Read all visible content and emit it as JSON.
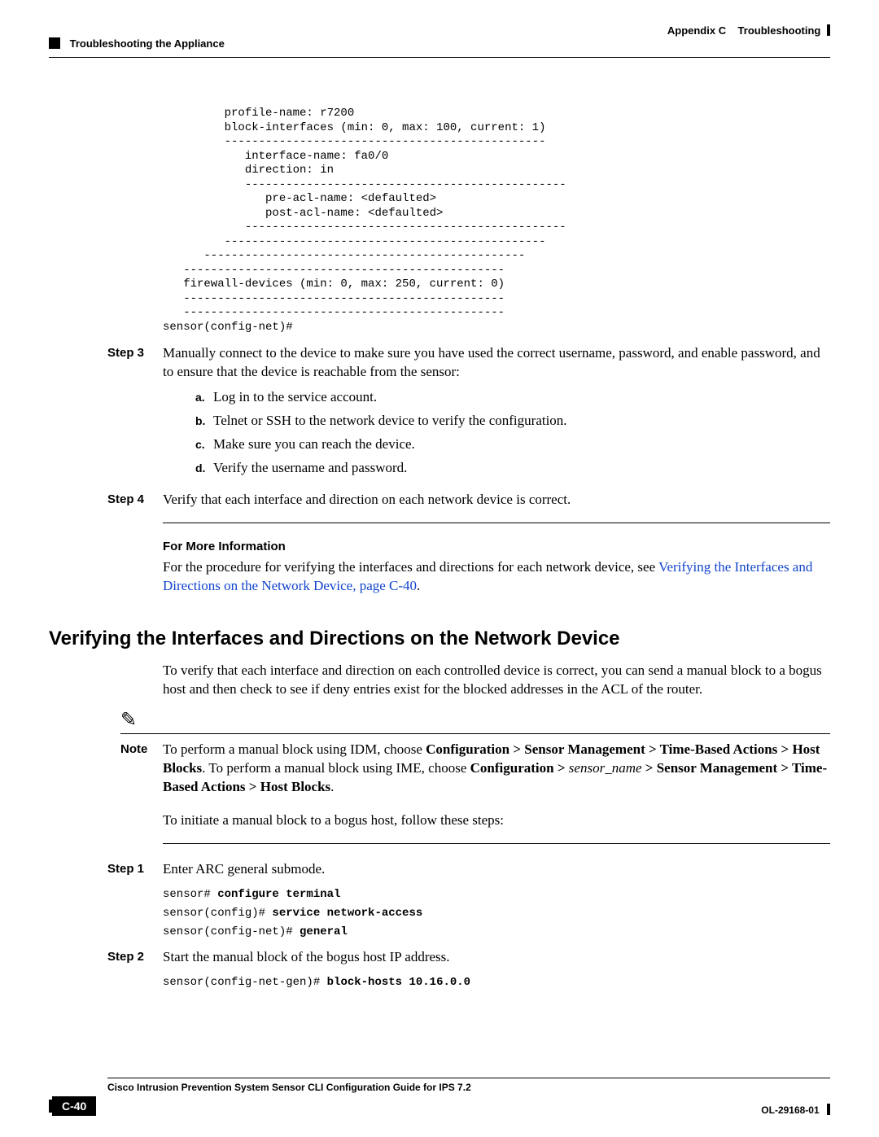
{
  "header": {
    "appendix": "Appendix C",
    "appendix_title": "Troubleshooting",
    "section": "Troubleshooting the Appliance"
  },
  "config_block": "         profile-name: r7200\n         block-interfaces (min: 0, max: 100, current: 1)\n         -----------------------------------------------\n            interface-name: fa0/0\n            direction: in\n            -----------------------------------------------\n               pre-acl-name: <defaulted>\n               post-acl-name: <defaulted>\n            -----------------------------------------------\n         -----------------------------------------------\n      -----------------------------------------------\n   -----------------------------------------------\n   firewall-devices (min: 0, max: 250, current: 0)\n   -----------------------------------------------\n   -----------------------------------------------\nsensor(config-net)#",
  "steps_a": {
    "s3_label": "Step 3",
    "s3_text": "Manually connect to the device to make sure you have used the correct username, password, and enable password, and to ensure that the device is reachable from the sensor:",
    "s3_a_l": "a.",
    "s3_a_t": "Log in to the service account.",
    "s3_b_l": "b.",
    "s3_b_t": "Telnet or SSH to the network device to verify the configuration.",
    "s3_c_l": "c.",
    "s3_c_t": "Make sure you can reach the device.",
    "s3_d_l": "d.",
    "s3_d_t": "Verify the username and password.",
    "s4_label": "Step 4",
    "s4_text": "Verify that each interface and direction on each network device is correct."
  },
  "more_info": {
    "heading": "For More Information",
    "pre": "For the procedure for verifying the interfaces and directions for each network device, see ",
    "link": "Verifying the Interfaces and Directions on the Network Device, page C-40",
    "post": "."
  },
  "section_heading": "Verifying the Interfaces and Directions on the Network Device",
  "intro_para": "To verify that each interface and direction on each controlled device is correct, you can send a manual block to a bogus host and then check to see if deny entries exist for the blocked addresses in the ACL of the router.",
  "note": {
    "label": "Note",
    "p1_pre": "To perform a manual block using IDM, choose ",
    "p1_b1": "Configuration > Sensor Management > Time-Based Actions > Host Blocks",
    "p1_mid": ". To perform a manual block using IME, choose ",
    "p1_b2": "Configuration > ",
    "p1_it": "sensor_name",
    "p1_b3": " > Sensor Management > Time-Based Actions > Host Blocks",
    "p1_post": "."
  },
  "initiate_para": "To initiate a manual block to a bogus host, follow these steps:",
  "steps_b": {
    "s1_label": "Step 1",
    "s1_text": "Enter ARC general submode.",
    "s1_code_l1_a": "sensor# ",
    "s1_code_l1_b": "configure terminal",
    "s1_code_l2_a": "sensor(config)# ",
    "s1_code_l2_b": "service network-access",
    "s1_code_l3_a": "sensor(config-net)# ",
    "s1_code_l3_b": "general",
    "s2_label": "Step 2",
    "s2_text": "Start the manual block of the bogus host IP address.",
    "s2_code_l1_a": "sensor(config-net-gen)# ",
    "s2_code_l1_b": "block-hosts 10.16.0.0"
  },
  "footer": {
    "title": "Cisco Intrusion Prevention System Sensor CLI Configuration Guide for IPS 7.2",
    "page": "C-40",
    "doc": "OL-29168-01"
  }
}
